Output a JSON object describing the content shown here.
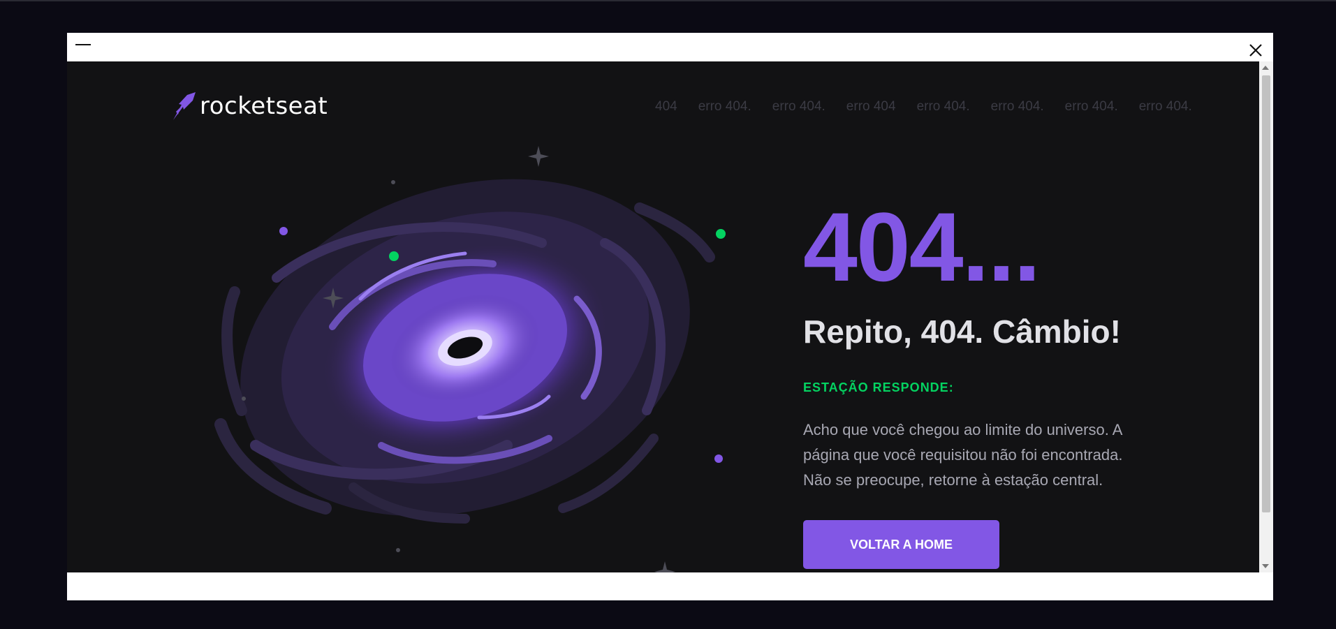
{
  "page": {
    "brand": "rocketseat",
    "marquee": [
      "404",
      "erro 404.",
      "erro 404.",
      "erro 404",
      "erro 404.",
      "erro 404.",
      "erro 404.",
      "erro 404."
    ],
    "headline": "404...",
    "subtitle": "Repito, 404. Câmbio!",
    "station_label": "ESTAÇÃO RESPONDE:",
    "message_lines": [
      "Acho que você chegou ao limite do universo. A",
      "página que você requisitou não foi encontrada.",
      "Não se preocupe, retorne à estação central."
    ],
    "home_button": "VOLTAR A HOME"
  },
  "colors": {
    "background": "#121214",
    "purple": "#8257e5",
    "green": "#04d361",
    "text_light": "#e1e1e6",
    "text_muted": "#a8a8b3",
    "marquee_text": "#3b3b44"
  },
  "icons": {
    "minimize": "minimize-icon",
    "close": "close-icon",
    "logo": "rocket-icon",
    "illustration": "galaxy-black-hole"
  }
}
